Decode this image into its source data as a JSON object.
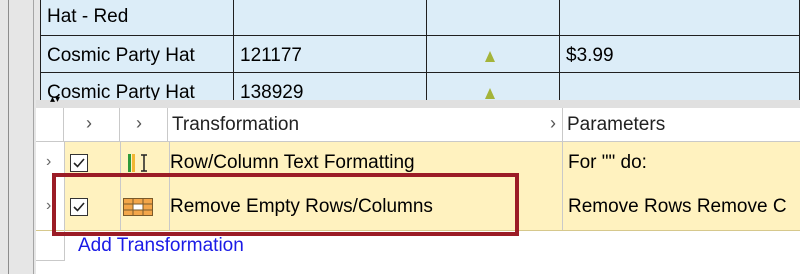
{
  "grid": {
    "rows": [
      {
        "name": "Hat - Red",
        "id": "",
        "price": ""
      },
      {
        "name": "Cosmic Party Hat",
        "id": "121177",
        "price": "$3.99"
      },
      {
        "name": "Cosmic Party Hat",
        "id": "138929",
        "price": ""
      }
    ]
  },
  "transform_panel": {
    "columns": {
      "transformation": "Transformation",
      "parameters": "Parameters"
    },
    "rows": [
      {
        "label": "Row/Column Text Formatting",
        "params": "For \"\" do:",
        "checked": true,
        "icon": "text-format-icon"
      },
      {
        "label": "Remove Empty Rows/Columns",
        "params": "Remove Rows Remove C",
        "checked": true,
        "icon": "table-grid-icon"
      }
    ],
    "add_label": "Add Transformation",
    "highlight_color": "#9b1c26",
    "row_color": "#fff2bf"
  }
}
